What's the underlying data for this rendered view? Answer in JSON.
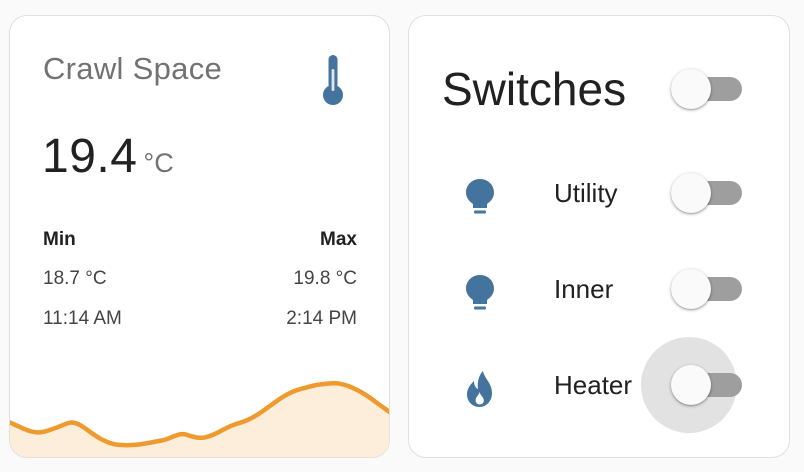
{
  "colors": {
    "icon_blue": "#44739e",
    "graph_line": "#ef9a2e",
    "graph_fill": "#fdeddb",
    "toggle_off_track": "#9e9e9e"
  },
  "sensor": {
    "name": "Crawl Space",
    "icon": "thermometer-icon",
    "value": "19.4",
    "unit": "°C",
    "min": {
      "label": "Min",
      "value": "18.7 °C",
      "time": "11:14 AM"
    },
    "max": {
      "label": "Max",
      "value": "19.8 °C",
      "time": "2:14 PM"
    },
    "history": [
      16.0,
      15.5,
      15.0,
      14.7,
      14.8,
      15.2,
      15.6,
      16.1,
      15.8,
      15.0,
      14.2,
      13.6,
      13.2,
      13.1,
      13.1,
      13.2,
      13.4,
      13.6,
      13.8,
      14.3,
      14.6,
      14.2,
      14.0,
      14.2,
      14.7,
      15.3,
      15.8,
      16.1,
      16.6,
      17.3,
      18.1,
      18.9,
      19.6,
      20.1,
      20.4,
      20.7,
      20.9,
      21.0,
      21.0,
      20.7,
      20.2,
      19.6,
      18.8,
      18.0,
      17.2
    ]
  },
  "switches": {
    "title": "Switches",
    "master_on": false,
    "items": [
      {
        "label": "Utility",
        "icon": "lightbulb-icon",
        "on": false
      },
      {
        "label": "Inner",
        "icon": "lightbulb-icon",
        "on": false
      },
      {
        "label": "Heater",
        "icon": "fire-icon",
        "on": false
      }
    ]
  }
}
